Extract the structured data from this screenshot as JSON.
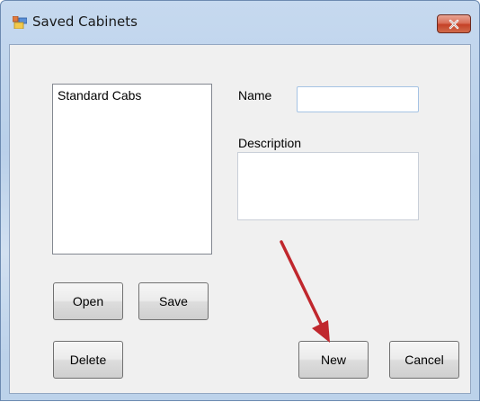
{
  "window": {
    "title": "Saved Cabinets",
    "close_icon": "close-icon",
    "app_icon": "form-icon"
  },
  "list": {
    "items": [
      "Standard Cabs"
    ]
  },
  "form": {
    "name_label": "Name",
    "name_value": "",
    "description_label": "Description",
    "description_value": ""
  },
  "buttons": {
    "open": "Open",
    "save": "Save",
    "delete": "Delete",
    "new": "New",
    "cancel": "Cancel"
  },
  "annotation": {
    "arrow_color": "#c0272d",
    "arrow_target": "new-button"
  }
}
